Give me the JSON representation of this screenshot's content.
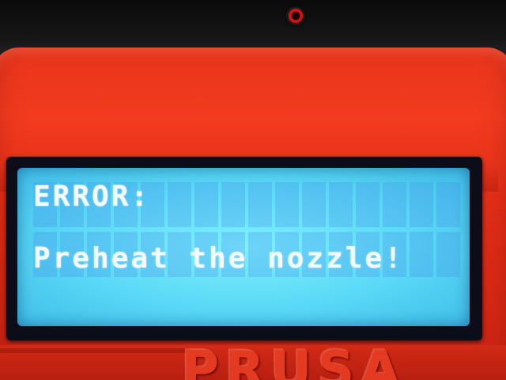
{
  "lcd": {
    "line1": "ERROR:",
    "line3": "Preheat the nozzle!"
  },
  "housing": {
    "brand": "PRUSA",
    "color": "#f23b1f"
  },
  "screen": {
    "backlight_color": "#5ad8f6",
    "text_color": "#f4fbff"
  }
}
